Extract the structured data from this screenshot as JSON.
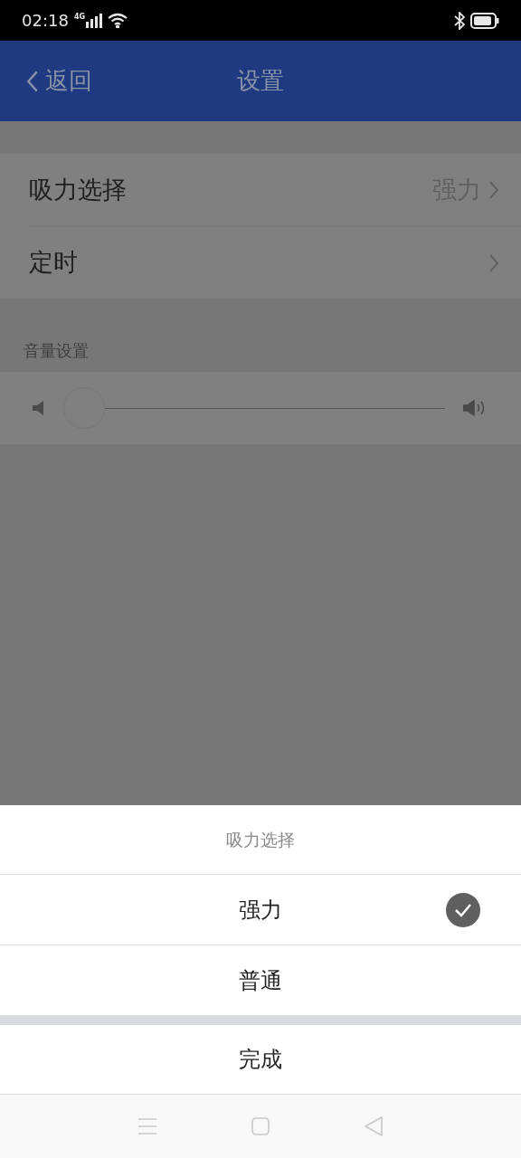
{
  "status_bar": {
    "time": "02:18",
    "network": "4G"
  },
  "header": {
    "back": "返回",
    "title": "设置"
  },
  "settings": [
    {
      "label": "吸力选择",
      "value": "强力"
    },
    {
      "label": "定时"
    }
  ],
  "volume": {
    "section": "音量设置",
    "level": 0
  },
  "sheet": {
    "title": "吸力选择",
    "options": [
      {
        "label": "强力",
        "selected": true
      },
      {
        "label": "普通",
        "selected": false
      }
    ],
    "done": "完成"
  }
}
